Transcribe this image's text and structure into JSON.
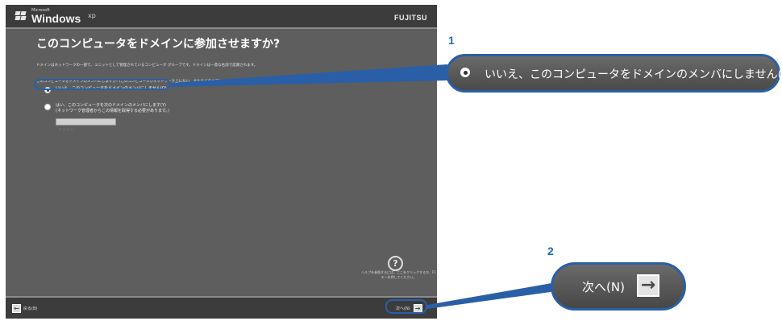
{
  "header": {
    "brand_small": "Microsoft",
    "brand": "Windows",
    "brand_suffix": "xp",
    "oem": "FUJITSU"
  },
  "page": {
    "title": "このコンピュータをドメインに参加させますか?",
    "desc1": "ドメインはネットワークの一部で、ユニットとして管理されているコンピュータ グループです。ドメインは一意な名前で認識されます。",
    "desc2": "このコンピュータをドメインのメンバにしますか? (このコンピュータがネットワーク上にない、またはどのオプションを選択するか確信がない場合は「いいえ」)"
  },
  "options": [
    {
      "label": "いいえ、このコンピュータをドメインのメンバにしません(O)",
      "selected": true
    },
    {
      "label": "はい、このコンピュータを次のドメインのメンバにします(Y)",
      "note": "(ネットワーク管理者からこの情報を取得する必要があります。)",
      "selected": false
    }
  ],
  "domain_input": {
    "value": "",
    "placeholder": "ドメイン"
  },
  "help": {
    "icon": "help-icon",
    "text": "ヘルプを参照するには、ここをクリックするか、F1 キーを押してください。"
  },
  "nav": {
    "back_label": "戻る(B)",
    "next_label": "次へ(N)"
  },
  "callouts": {
    "step1_number": "1",
    "step1_text": "いいえ、このコンピュータをドメインのメンバにしません(O)",
    "step2_number": "2",
    "step2_text": "次へ(N)"
  },
  "colors": {
    "accent": "#2a5fa8",
    "number": "#1e6fb0",
    "screen_bg": "#5e5e5e",
    "bar_bg": "#3c3c3c"
  }
}
